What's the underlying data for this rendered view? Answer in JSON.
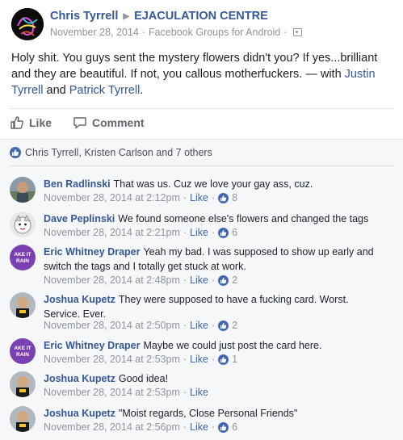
{
  "post": {
    "author": "Chris Tyrrell",
    "group": "EJACULATION CENTRE",
    "date": "November 28, 2014",
    "source": "Facebook Groups for Android",
    "text_main": "Holy shit. You guys sent the mystery flowers didn't you? If yes...brilliant and they are beautiful. If not, you callous motherfuckers. — with ",
    "tag_1": "Justin Tyrrell",
    "and_text": " and ",
    "tag_2": "Patrick Tyrrell",
    "end_text": "."
  },
  "actions": {
    "like_label": "Like",
    "comment_label": "Comment"
  },
  "reactions": {
    "summary": "Chris Tyrrell, Kristen Carlson and 7 others"
  },
  "comments": [
    {
      "author": "Ben Radlinski",
      "text": "That was us. Cuz we love your gay ass, cuz.",
      "time": "November 28, 2014 at 2:12pm",
      "like_label": "Like",
      "likes": "8"
    },
    {
      "author": "Dave Peplinski",
      "text": "We found someone else's flowers and changed the tags",
      "time": "November 28, 2014 at 2:21pm",
      "like_label": "Like",
      "likes": "6"
    },
    {
      "author": "Eric Whitney Draper",
      "text": "Yeah my bad. I was supposed to show up early and switch the tags and I totally get stuck at work.",
      "time": "November 28, 2014 at 2:48pm",
      "like_label": "Like",
      "likes": "2"
    },
    {
      "author": "Joshua Kupetz",
      "text": "They were supposed to have a fucking card. Worst. Service. Ever.",
      "time": "November 28, 2014 at 2:50pm",
      "like_label": "Like",
      "likes": "2"
    },
    {
      "author": "Eric Whitney Draper",
      "text": "Maybe we could just post the card here.",
      "time": "November 28, 2014 at 2:53pm",
      "like_label": "Like",
      "likes": "1"
    },
    {
      "author": "Joshua Kupetz",
      "text": "Good idea!",
      "time": "November 28, 2014 at 2:53pm",
      "like_label": "Like",
      "likes": ""
    },
    {
      "author": "Joshua Kupetz",
      "text": "\"Moist regards, Close Personal Friends\"",
      "time": "November 28, 2014 at 2:56pm",
      "like_label": "Like",
      "likes": "6"
    }
  ],
  "avatars": {
    "ben": "photo-avatar",
    "dave": "cartoon-avatar",
    "eric": "make-it-rain-avatar",
    "joshua": "photo-avatar"
  },
  "avatar_text": {
    "eric_line1": "AKE IT",
    "eric_line2": "RAIN"
  },
  "colors": {
    "link": "#365899",
    "meta": "#90949c",
    "like_blue": "#4267b2",
    "panel_bg": "#f6f7f9"
  }
}
